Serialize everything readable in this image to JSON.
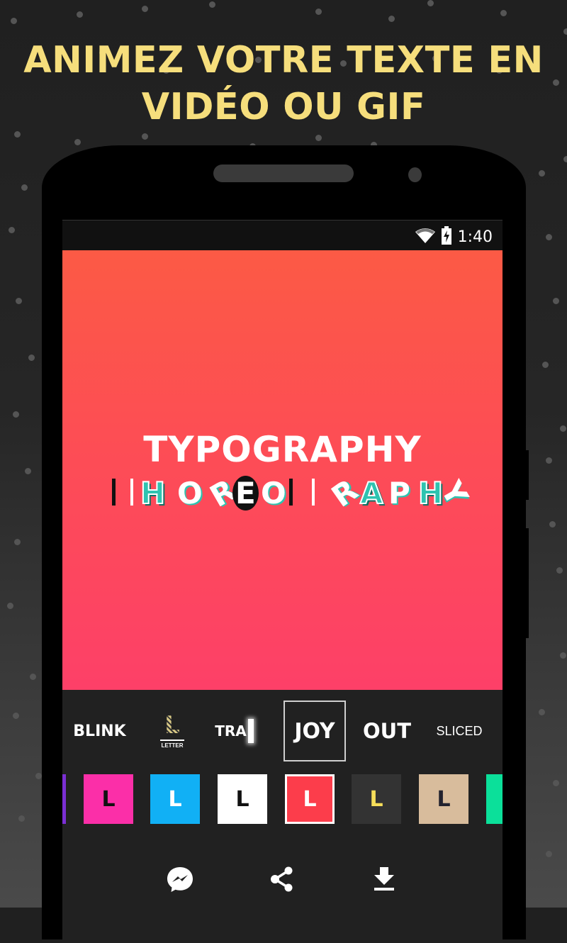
{
  "headline": {
    "line1": "ANIMEZ VOTRE TEXTE EN",
    "line2": "VIDÉO OU GIF",
    "color": "#f6de7c"
  },
  "status_bar": {
    "icons": [
      "wifi-icon",
      "battery-charging-icon"
    ],
    "time": "1:40"
  },
  "preview": {
    "title": "TYPOGRAPHY",
    "animated_text_letters": [
      "H",
      "O",
      "R",
      "E",
      "O",
      "R",
      "A",
      "P",
      "H",
      "Y"
    ],
    "gradient_colors": [
      "#fc5a45",
      "#fd4068"
    ]
  },
  "style_picker": {
    "items": [
      {
        "label": "BLINK",
        "selected": false
      },
      {
        "label": "LETTER",
        "glyph": "L",
        "selected": false
      },
      {
        "label": "TRA",
        "selected": false
      },
      {
        "label": "JOY",
        "selected": true
      },
      {
        "label": "OUT",
        "selected": false
      },
      {
        "label": "SLICED",
        "selected": false
      }
    ]
  },
  "color_picker": {
    "swatches": [
      {
        "bg": "#7b2fd4",
        "fg": "#ffffff",
        "glyph": "",
        "partial": true,
        "selected": false
      },
      {
        "bg": "#fb2fa8",
        "fg": "#111111",
        "glyph": "L",
        "selected": false
      },
      {
        "bg": "#11b0f5",
        "fg": "#ffffff",
        "glyph": "L",
        "selected": false
      },
      {
        "bg": "#ffffff",
        "fg": "#111111",
        "glyph": "L",
        "selected": false
      },
      {
        "bg": "#fc3d4b",
        "fg": "#ffffff",
        "glyph": "L",
        "selected": true
      },
      {
        "bg": "#333333",
        "fg": "#f6de5a",
        "glyph": "L",
        "selected": false
      },
      {
        "bg": "#d8bc9c",
        "fg": "#22222e",
        "glyph": "L",
        "selected": false
      },
      {
        "bg": "#0be09a",
        "fg": "#ffffff",
        "glyph": "",
        "partial": true,
        "selected": false
      }
    ]
  },
  "actions": [
    {
      "name": "messenger-icon",
      "label": "Messenger"
    },
    {
      "name": "share-icon",
      "label": "Share"
    },
    {
      "name": "download-icon",
      "label": "Download"
    }
  ]
}
